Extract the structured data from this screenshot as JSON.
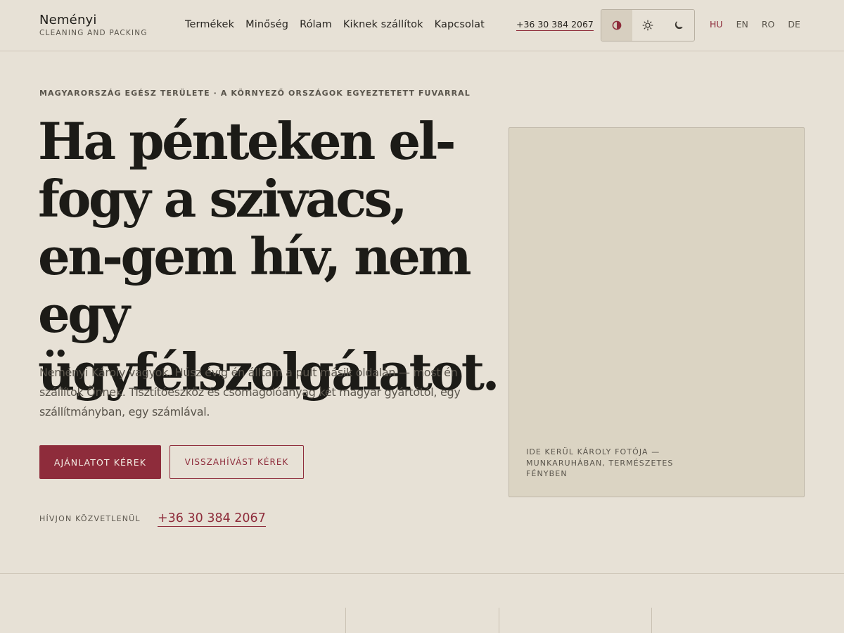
{
  "header": {
    "brand_name": "Neményi",
    "brand_tagline": "CLEANING AND PACKING",
    "nav": [
      "Termékek",
      "Minőség",
      "Rólam",
      "Kiknek szállítok",
      "Kapcsolat"
    ],
    "phone": "+36 30 384 2067",
    "theme_options": [
      {
        "icon": "contrast-icon",
        "active": true
      },
      {
        "icon": "sun-icon",
        "active": false
      },
      {
        "icon": "moon-icon",
        "active": false
      }
    ],
    "languages": [
      "HU",
      "EN",
      "RO",
      "DE"
    ],
    "active_language": "HU"
  },
  "hero": {
    "kicker": "MAGYARORSZÁG EGÉSZ TERÜLETE · A KÖRNYEZŐ ORSZÁGOK EGYEZTETETT FUVARRAL",
    "headline": "Ha pénteken el-fogy a szivacs, en-gem hív, nem egy ügyfélszolgálatot.",
    "lead": "Neményi Károly vagyok. Húsz évig én álltam a pult másik oldalán — most én szállítok Önnek. Tisztítóeszköz és csomagolóanyag két magyar gyártótól, egy szállítmányban, egy számlával.",
    "primary_cta": "AJÁNLATOT KÉREK",
    "secondary_cta": "VISSZAHÍVÁST KÉREK",
    "call_label": "HÍVJON KÖZVETLENÜL",
    "call_phone": "+36 30 384 2067",
    "photo_caption": "IDE KERÜL KÁROLY FOTÓJA — MUNKARUHÁBAN, TERMÉSZETES FÉNYBEN"
  },
  "colors": {
    "background": "#e7e1d6",
    "accent": "#8e2c3b",
    "text": "#1f1d19",
    "muted": "#5a554c",
    "placeholder": "#dbd4c3"
  }
}
